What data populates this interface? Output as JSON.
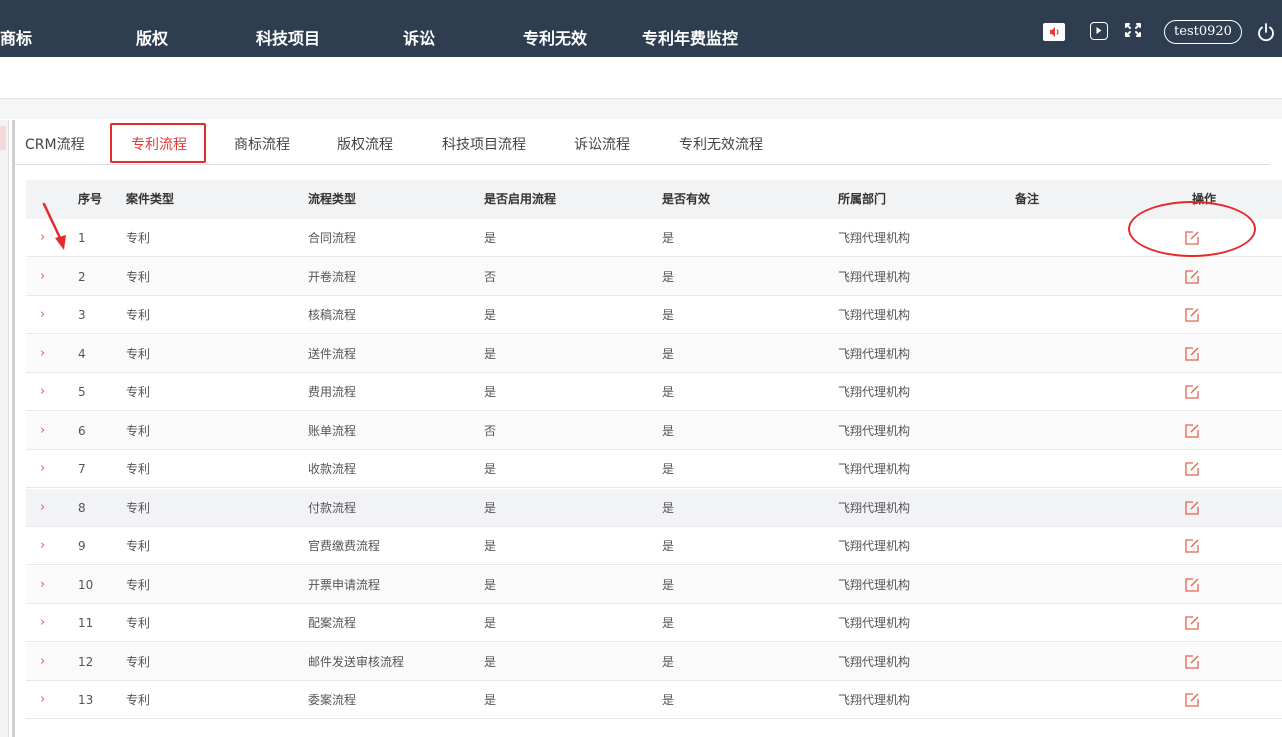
{
  "topnav": {
    "items": [
      "商标",
      "版权",
      "科技项目",
      "诉讼",
      "专利无效",
      "专利年费监控"
    ],
    "username": "test0920"
  },
  "tabs": {
    "items": [
      "CRM流程",
      "专利流程",
      "商标流程",
      "版权流程",
      "科技项目流程",
      "诉讼流程",
      "专利无效流程"
    ],
    "active_index": 1
  },
  "table": {
    "columns": [
      "序号",
      "案件类型",
      "流程类型",
      "是否启用流程",
      "是否有效",
      "所属部门",
      "备注",
      "操作"
    ],
    "rows": [
      {
        "no": "1",
        "case_type": "专利",
        "flow_type": "合同流程",
        "enabled": "是",
        "valid": "是",
        "dept": "飞翔代理机构",
        "remark": ""
      },
      {
        "no": "2",
        "case_type": "专利",
        "flow_type": "开卷流程",
        "enabled": "否",
        "valid": "是",
        "dept": "飞翔代理机构",
        "remark": ""
      },
      {
        "no": "3",
        "case_type": "专利",
        "flow_type": "核稿流程",
        "enabled": "是",
        "valid": "是",
        "dept": "飞翔代理机构",
        "remark": ""
      },
      {
        "no": "4",
        "case_type": "专利",
        "flow_type": "送件流程",
        "enabled": "是",
        "valid": "是",
        "dept": "飞翔代理机构",
        "remark": ""
      },
      {
        "no": "5",
        "case_type": "专利",
        "flow_type": "费用流程",
        "enabled": "是",
        "valid": "是",
        "dept": "飞翔代理机构",
        "remark": ""
      },
      {
        "no": "6",
        "case_type": "专利",
        "flow_type": "账单流程",
        "enabled": "否",
        "valid": "是",
        "dept": "飞翔代理机构",
        "remark": ""
      },
      {
        "no": "7",
        "case_type": "专利",
        "flow_type": "收款流程",
        "enabled": "是",
        "valid": "是",
        "dept": "飞翔代理机构",
        "remark": ""
      },
      {
        "no": "8",
        "case_type": "专利",
        "flow_type": "付款流程",
        "enabled": "是",
        "valid": "是",
        "dept": "飞翔代理机构",
        "remark": ""
      },
      {
        "no": "9",
        "case_type": "专利",
        "flow_type": "官费缴费流程",
        "enabled": "是",
        "valid": "是",
        "dept": "飞翔代理机构",
        "remark": ""
      },
      {
        "no": "10",
        "case_type": "专利",
        "flow_type": "开票申请流程",
        "enabled": "是",
        "valid": "是",
        "dept": "飞翔代理机构",
        "remark": ""
      },
      {
        "no": "11",
        "case_type": "专利",
        "flow_type": "配案流程",
        "enabled": "是",
        "valid": "是",
        "dept": "飞翔代理机构",
        "remark": ""
      },
      {
        "no": "12",
        "case_type": "专利",
        "flow_type": "邮件发送审核流程",
        "enabled": "是",
        "valid": "是",
        "dept": "飞翔代理机构",
        "remark": ""
      },
      {
        "no": "13",
        "case_type": "专利",
        "flow_type": "委案流程",
        "enabled": "是",
        "valid": "是",
        "dept": "飞翔代理机构",
        "remark": ""
      }
    ]
  },
  "colors": {
    "header_bg": "#2e3e50",
    "accent_red": "#e32b2b",
    "edit_icon": "#e8604a"
  },
  "icons": {
    "speaker": "speaker-icon",
    "play": "play-icon",
    "fullscreen": "fullscreen-icon",
    "power": "power-icon",
    "edit": "edit-icon",
    "expand": "chevron-right-icon"
  }
}
